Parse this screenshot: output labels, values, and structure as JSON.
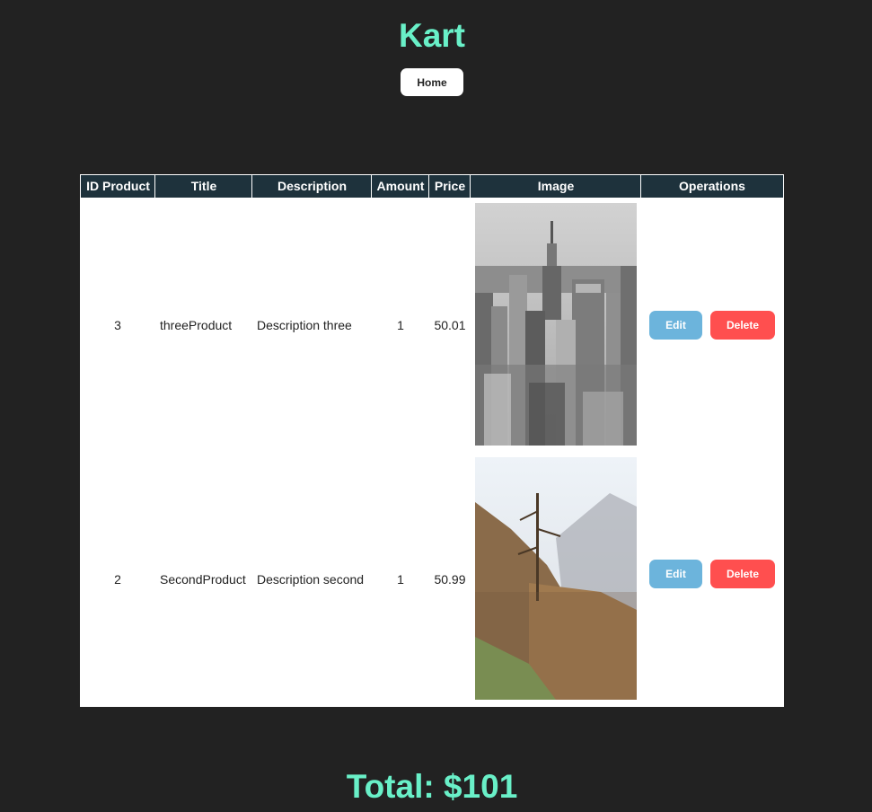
{
  "header": {
    "title": "Kart",
    "home_label": "Home"
  },
  "table": {
    "columns": [
      "ID Product",
      "Title",
      "Description",
      "Amount",
      "Price",
      "Image",
      "Operations"
    ],
    "rows": [
      {
        "id": "3",
        "title": "threeProduct",
        "description": "Description three",
        "amount": "1",
        "price": "50.01",
        "image": "city-skyline-photo",
        "edit_label": "Edit",
        "delete_label": "Delete"
      },
      {
        "id": "2",
        "title": "SecondProduct",
        "description": "Description second",
        "amount": "1",
        "price": "50.99",
        "image": "mountain-forest-photo",
        "edit_label": "Edit",
        "delete_label": "Delete"
      }
    ]
  },
  "footer": {
    "total": "Total: $101"
  },
  "colors": {
    "background": "#222222",
    "accent": "#69f0c8",
    "header_bg": "#1e323c",
    "edit": "#6cb4dc",
    "delete": "#ff4f4f"
  }
}
